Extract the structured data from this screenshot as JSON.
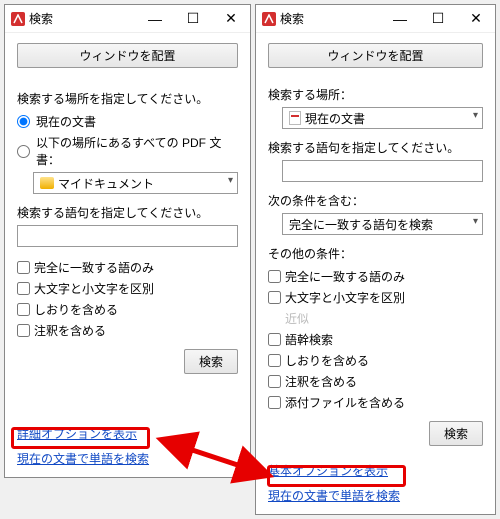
{
  "app_title": "検索",
  "window_controls": {
    "min": "—",
    "max": "☐",
    "close": "✕"
  },
  "arrange_windows": "ウィンドウを配置",
  "left": {
    "location_prompt": "検索する場所を指定してください。",
    "radio_current": "現在の文書",
    "radio_all_pdf": "以下の場所にあるすべての PDF 文書：",
    "folder_combo": "マイドキュメント",
    "term_prompt": "検索する語句を指定してください。",
    "opt_exact": "完全に一致する語のみ",
    "opt_case": "大文字と小文字を区別",
    "opt_bookmarks": "しおりを含める",
    "opt_comments": "注釈を含める",
    "search_btn": "検索",
    "link_advanced": "詳細オプションを表示",
    "link_search_current": "現在の文書で単語を検索"
  },
  "right": {
    "location_label": "検索する場所：",
    "location_combo": "現在の文書",
    "term_prompt": "検索する語句を指定してください。",
    "conditions_label": "次の条件を含む：",
    "conditions_combo": "完全に一致する語句を検索",
    "other_label": "その他の条件：",
    "opt_exact": "完全に一致する語のみ",
    "opt_case": "大文字と小文字を区別",
    "opt_nearby": "近似",
    "opt_stemming": "語幹検索",
    "opt_bookmarks": "しおりを含める",
    "opt_comments": "注釈を含める",
    "opt_attachments": "添付ファイルを含める",
    "search_btn": "検索",
    "link_basic": "基本オプションを表示",
    "link_search_current": "現在の文書で単語を検索"
  }
}
